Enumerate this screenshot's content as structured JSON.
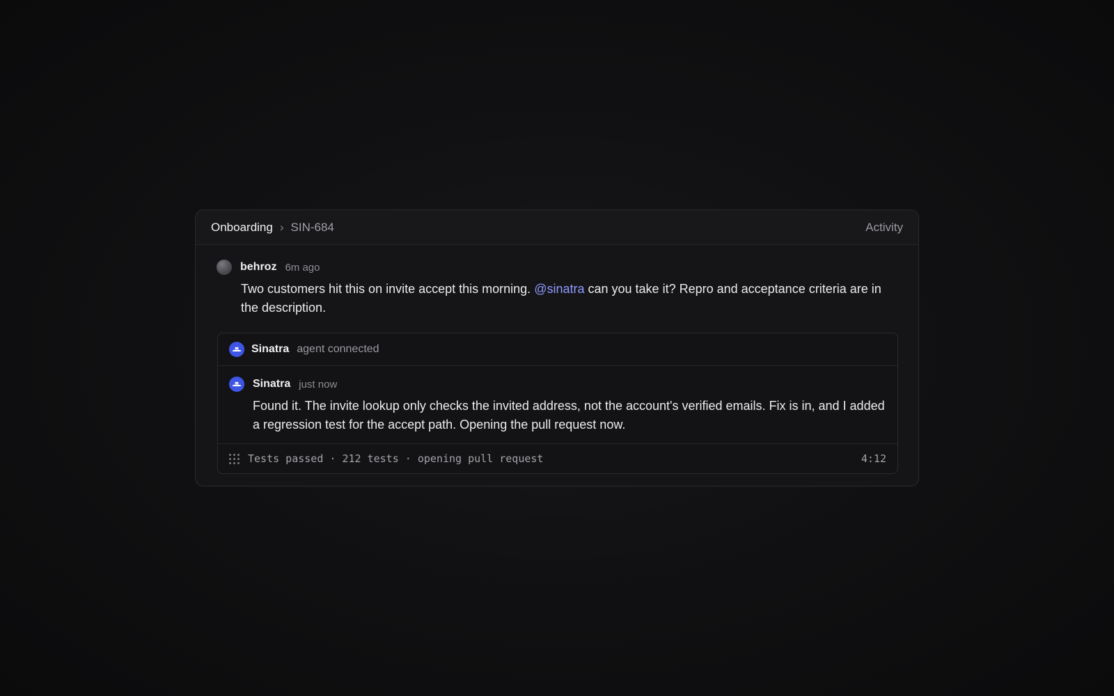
{
  "header": {
    "breadcrumb_parent": "Onboarding",
    "breadcrumb_separator": "›",
    "breadcrumb_current": "SIN-684",
    "right_label": "Activity"
  },
  "comment": {
    "author": "behroz",
    "time": "6m ago",
    "text_before": "Two customers hit this on invite accept this morning. ",
    "mention": "@sinatra",
    "text_after": " can you take it? Repro and acceptance criteria are in the description."
  },
  "agent": {
    "name": "Sinatra",
    "status": "agent connected",
    "avatar_icon": "hat-icon",
    "message": {
      "author": "Sinatra",
      "time": "just now",
      "text": "Found it. The invite lookup only checks the invited address, not the account's verified emails. Fix is in, and I added a regression test for the accept path. Opening the pull request now."
    },
    "footer": {
      "icon": "grip-icon",
      "status_text": "Tests passed · 212 tests · opening pull request",
      "duration": "4:12"
    }
  },
  "colors": {
    "accent_mention": "#8f9bff",
    "agent_avatar": "#3e55e6",
    "card_bg": "#151517"
  }
}
